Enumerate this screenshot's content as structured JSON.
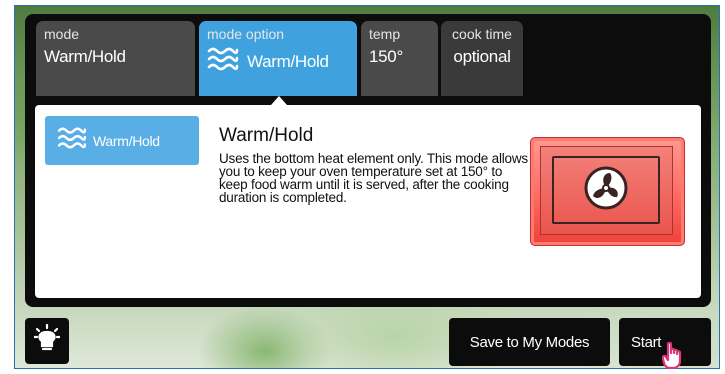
{
  "tabs": [
    {
      "label": "mode",
      "value": "Warm/Hold"
    },
    {
      "label": "mode option",
      "value": "Warm/Hold"
    },
    {
      "label": "temp",
      "value": "150°"
    },
    {
      "label": "cook time",
      "value": "optional"
    }
  ],
  "selected_mode": {
    "chip_label": "Warm/Hold",
    "title": "Warm/Hold",
    "description": "Uses the bottom heat element only. This mode allows you to keep your oven temperature set at 150° to keep food warm until it is served, after the cooking duration is completed."
  },
  "actions": {
    "save_label": "Save to My Modes",
    "start_label": "Start"
  },
  "icons": {
    "light": "light-bulb-icon",
    "mode": "heat-waves-icon",
    "oven": "fan-icon"
  },
  "colors": {
    "accent": "#3fa2df",
    "tab": "#4a4a4a",
    "oven": "#ff6a60"
  }
}
